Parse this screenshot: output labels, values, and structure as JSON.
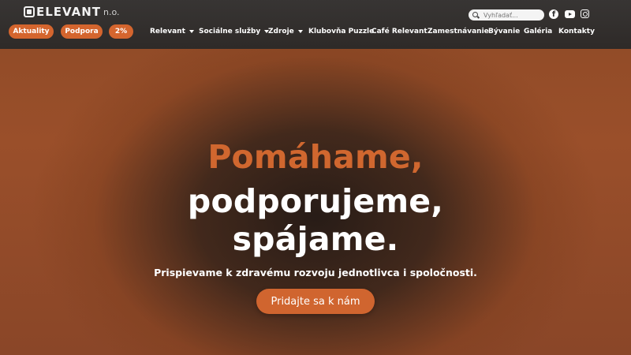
{
  "header": {
    "logo": {
      "brand": "ELEVANT",
      "suffix": "n.o."
    },
    "pills": [
      {
        "label": "Aktuality"
      },
      {
        "label": "Podpora"
      },
      {
        "label": "2%"
      }
    ],
    "nav": [
      {
        "label": "Relevant",
        "has_dropdown": true
      },
      {
        "label": "Sociálne služby",
        "has_dropdown": true
      },
      {
        "label": "Zdroje",
        "has_dropdown": true
      },
      {
        "label": "Klubovňa Puzzle",
        "has_dropdown": false
      },
      {
        "label": "Café Relevant",
        "has_dropdown": false
      },
      {
        "label": "Zamestnávanie",
        "has_dropdown": false
      },
      {
        "label": "Bývanie",
        "has_dropdown": false
      },
      {
        "label": "Galéria",
        "has_dropdown": false
      },
      {
        "label": "Kontakty",
        "has_dropdown": false
      }
    ],
    "search": {
      "placeholder": "Vyhľadať...",
      "value": ""
    },
    "social": [
      {
        "icon": "facebook-icon"
      },
      {
        "icon": "youtube-icon"
      },
      {
        "icon": "instagram-icon"
      }
    ]
  },
  "hero": {
    "headline_line1": "Pomáhame,",
    "headline_line2": "podporujeme,",
    "headline_line3": "spájame.",
    "subtitle": "Prispievame k zdravému rozvoju jednotlivca i spoločnosti.",
    "cta_label": "Pridajte sa k nám"
  },
  "colors": {
    "accent": "#d0652f",
    "topbar": "#343434",
    "hero_dark": "#2a201b",
    "hero_edge": "#9a4f2a"
  }
}
